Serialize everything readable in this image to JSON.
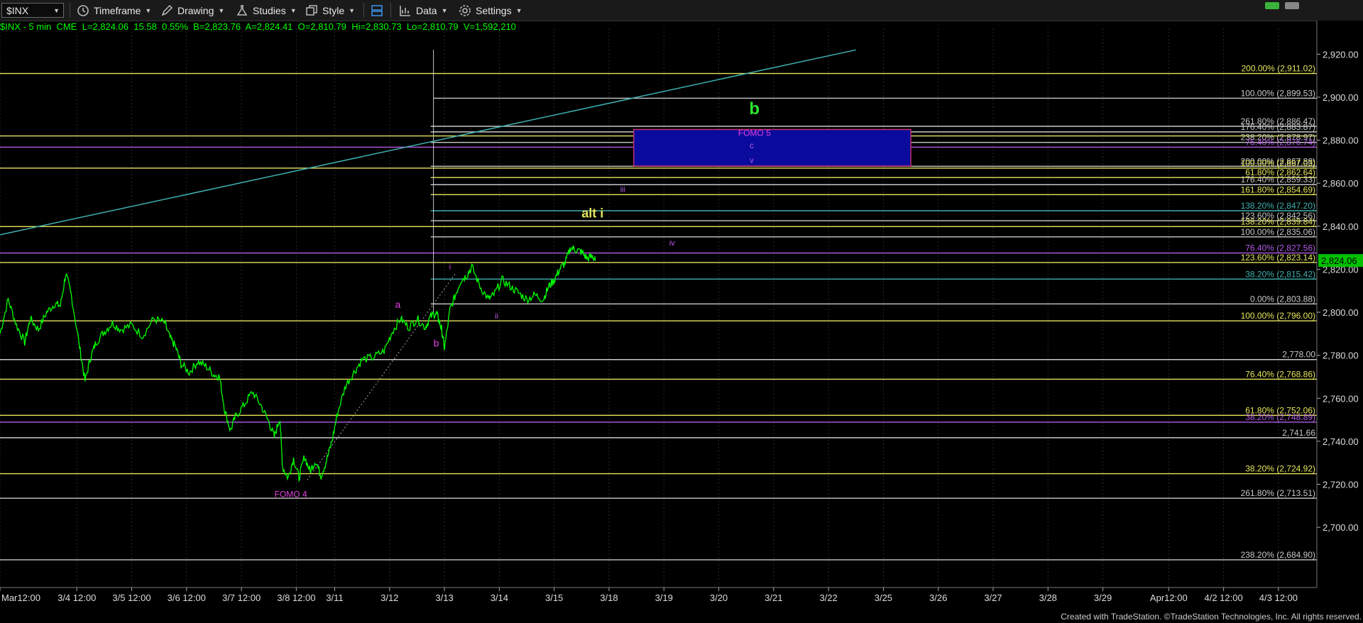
{
  "toolbar": {
    "symbol": "$INX",
    "timeframe": "Timeframe",
    "drawing": "Drawing",
    "studies": "Studies",
    "style": "Style",
    "data": "Data",
    "settings": "Settings"
  },
  "infobar": {
    "title": "$INX - 5 min  CME",
    "last": "L=2,824.06",
    "chg": "15.58",
    "pct": "0.55%",
    "bid": "B=2,823.76",
    "ask": "A=2,824.41",
    "open": "O=2,810.79",
    "hi": "Hi=2,830.73",
    "lo": "Lo=2,810.79",
    "vol": "V=1,592,210"
  },
  "footer": "Created with TradeStation. ©TradeStation Technologies, Inc. All rights reserved.",
  "colors": {
    "price": "#00ff00",
    "yellow": "#e6e65c",
    "white": "#c8c8c8",
    "teal": "#3fb0b0",
    "purple": "#b45ce6",
    "magenta": "#e040e0",
    "box": "#0a0a9c"
  },
  "chart_data": {
    "type": "line",
    "title": "",
    "xlabel": "",
    "ylabel": "",
    "ylim": [
      2672,
      2932
    ],
    "y_ticks": [
      2700,
      2720,
      2740,
      2760,
      2780,
      2800,
      2820,
      2840,
      2860,
      2880,
      2900,
      2920
    ],
    "y_tick_labels": [
      "2,700.00",
      "2,720.00",
      "2,740.00",
      "2,760.00",
      "2,780.00",
      "2,800.00",
      "2,820.00",
      "2,840.00",
      "2,860.00",
      "2,880.00",
      "2,900.00",
      "2,920.00"
    ],
    "x_range": [
      0,
      24
    ],
    "x_ticks": [
      {
        "x": 0.0,
        "label": "Mar12:00"
      },
      {
        "x": 1.4,
        "label": "3/4 12:00"
      },
      {
        "x": 2.4,
        "label": "3/5 12:00"
      },
      {
        "x": 3.4,
        "label": "3/6 12:00"
      },
      {
        "x": 4.4,
        "label": "3/7 12:00"
      },
      {
        "x": 5.4,
        "label": "3/8 12:00"
      },
      {
        "x": 6.1,
        "label": "3/11"
      },
      {
        "x": 7.1,
        "label": "3/12"
      },
      {
        "x": 8.1,
        "label": "3/13"
      },
      {
        "x": 9.1,
        "label": "3/14"
      },
      {
        "x": 10.1,
        "label": "3/15"
      },
      {
        "x": 11.1,
        "label": "3/18"
      },
      {
        "x": 12.1,
        "label": "3/19"
      },
      {
        "x": 13.1,
        "label": "3/20"
      },
      {
        "x": 14.1,
        "label": "3/21"
      },
      {
        "x": 15.1,
        "label": "3/22"
      },
      {
        "x": 16.1,
        "label": "3/25"
      },
      {
        "x": 17.1,
        "label": "3/26"
      },
      {
        "x": 18.1,
        "label": "3/27"
      },
      {
        "x": 19.1,
        "label": "3/28"
      },
      {
        "x": 20.1,
        "label": "3/29"
      },
      {
        "x": 21.3,
        "label": "Apr12:00"
      },
      {
        "x": 22.3,
        "label": "4/2 12:00"
      },
      {
        "x": 23.3,
        "label": "4/3 12:00"
      }
    ],
    "price": {
      "x": [
        0.0,
        0.15,
        0.3,
        0.45,
        0.55,
        0.7,
        0.85,
        1.0,
        1.1,
        1.2,
        1.3,
        1.45,
        1.55,
        1.65,
        1.75,
        1.9,
        2.05,
        2.2,
        2.4,
        2.6,
        2.8,
        3.0,
        3.1,
        3.2,
        3.3,
        3.45,
        3.6,
        3.75,
        3.9,
        4.0,
        4.1,
        4.2,
        4.3,
        4.45,
        4.6,
        4.75,
        4.9,
        5.0,
        5.1,
        5.15,
        5.25,
        5.35,
        5.45,
        5.55,
        5.65,
        5.75,
        5.85,
        5.95,
        6.05,
        6.15,
        6.3,
        6.45,
        6.6,
        6.8,
        7.0,
        7.15,
        7.3,
        7.45,
        7.6,
        7.75,
        7.85,
        7.95,
        8.0,
        8.05,
        8.1,
        8.2,
        8.3,
        8.4,
        8.5,
        8.6,
        8.75,
        8.9,
        9.0,
        9.15,
        9.3,
        9.45,
        9.6,
        9.75,
        9.9,
        10.0,
        10.1,
        10.2,
        10.3,
        10.4,
        10.5,
        10.6,
        10.7,
        10.8,
        10.85
      ],
      "y": [
        2790,
        2806,
        2794,
        2786,
        2797,
        2792,
        2800,
        2804,
        2803,
        2818,
        2808,
        2784,
        2768,
        2779,
        2786,
        2791,
        2795,
        2792,
        2794,
        2789,
        2797,
        2795,
        2788,
        2784,
        2776,
        2772,
        2777,
        2775,
        2771,
        2770,
        2754,
        2745,
        2752,
        2757,
        2763,
        2757,
        2749,
        2742,
        2751,
        2728,
        2723,
        2732,
        2723,
        2733,
        2726,
        2731,
        2724,
        2731,
        2740,
        2753,
        2766,
        2772,
        2778,
        2779,
        2782,
        2791,
        2797,
        2793,
        2797,
        2793,
        2798,
        2800,
        2796,
        2792,
        2783,
        2801,
        2808,
        2815,
        2817,
        2821,
        2812,
        2806,
        2808,
        2815,
        2812,
        2809,
        2806,
        2808,
        2806,
        2812,
        2815,
        2820,
        2823,
        2830,
        2829,
        2828,
        2825,
        2826,
        2824
      ]
    },
    "trendline": {
      "x1": 0.0,
      "y1": 2836,
      "x2": 15.6,
      "y2": 2922
    },
    "dotted_line": {
      "x1": 5.6,
      "y1": 2722,
      "x2": 8.3,
      "y2": 2818
    },
    "vertical_line_x": 7.9,
    "levels": [
      {
        "y": 2911.02,
        "label": "200.00% (2,911.02)",
        "color": "yellow",
        "x_start": 0
      },
      {
        "y": 2899.53,
        "label": "100.00% (2,899.53)",
        "color": "white",
        "x_start": 7.9
      },
      {
        "y": 2886.47,
        "label": "261.80% (2,886.47)",
        "color": "white",
        "x_start": 7.85
      },
      {
        "y": 2883.87,
        "label": "176.40% (2,883.87)",
        "color": "white",
        "x_start": 7.85
      },
      {
        "y": 2882.0,
        "label": "",
        "color": "yellow",
        "x_start": 0
      },
      {
        "y": 2878.97,
        "label": "238.20% (2,878.97)",
        "color": "white",
        "x_start": 7.85
      },
      {
        "y": 2876.74,
        "label": "76.40% (2,876.74)",
        "color": "purple",
        "x_start": 0
      },
      {
        "y": 2867.88,
        "label": "200.00% (2,867.88)",
        "color": "white",
        "x_start": 7.85
      },
      {
        "y": 2867.03,
        "label": "100.00% (2,867.03)",
        "color": "yellow",
        "x_start": 0
      },
      {
        "y": 2862.64,
        "label": "61.80% (2,862.64)",
        "color": "yellow",
        "x_start": 7.85
      },
      {
        "y": 2859.33,
        "label": "176.40% (2,859.33)",
        "color": "white",
        "x_start": 7.85
      },
      {
        "y": 2854.69,
        "label": "161.80% (2,854.69)",
        "color": "yellow",
        "x_start": 7.85
      },
      {
        "y": 2847.2,
        "label": "138.20% (2,847.20)",
        "color": "teal",
        "x_start": 7.85
      },
      {
        "y": 2842.56,
        "label": "123.60% (2,842.56)",
        "color": "white",
        "x_start": 7.85
      },
      {
        "y": 2839.84,
        "label": "138.20% (2,839.84)",
        "color": "yellow",
        "x_start": 0
      },
      {
        "y": 2835.06,
        "label": "100.00% (2,835.06)",
        "color": "white",
        "x_start": 7.85
      },
      {
        "y": 2827.56,
        "label": "76.40% (2,827.56)",
        "color": "purple",
        "x_start": 0
      },
      {
        "y": 2823.14,
        "label": "123.60% (2,823.14)",
        "color": "yellow",
        "x_start": 0
      },
      {
        "y": 2815.42,
        "label": "38.20% (2,815.42)",
        "color": "teal",
        "x_start": 7.85
      },
      {
        "y": 2803.88,
        "label": "0.00% (2,803.88)",
        "color": "white",
        "x_start": 7.85
      },
      {
        "y": 2796.0,
        "label": "100.00% (2,796.00)",
        "color": "yellow",
        "x_start": 0
      },
      {
        "y": 2778.0,
        "label": "2,778.00",
        "color": "white",
        "x_start": 0
      },
      {
        "y": 2768.86,
        "label": "76.40% (2,768.86)",
        "color": "yellow",
        "x_start": 0
      },
      {
        "y": 2752.06,
        "label": "61.80% (2,752.06)",
        "color": "yellow",
        "x_start": 0
      },
      {
        "y": 2748.89,
        "label": "38.20% (2,748.89)",
        "color": "purple",
        "x_start": 0
      },
      {
        "y": 2741.66,
        "label": "2,741.66",
        "color": "white",
        "x_start": 0
      },
      {
        "y": 2724.92,
        "label": "38.20% (2,724.92)",
        "color": "yellow",
        "x_start": 0
      },
      {
        "y": 2713.51,
        "label": "261.80% (2,713.51)",
        "color": "white",
        "x_start": 0
      },
      {
        "y": 2684.9,
        "label": "238.20% (2,684.90)",
        "color": "white",
        "x_start": 0
      }
    ],
    "box": {
      "x1": 11.55,
      "x2": 16.6,
      "y1": 2868,
      "y2": 2885
    },
    "wave_labels": [
      {
        "text": "b",
        "x": 13.75,
        "y": 2892,
        "color": "#2ee62e",
        "size": 24,
        "bold": true
      },
      {
        "text": "FOMO 5",
        "x": 13.75,
        "y": 2882,
        "color": "#e040e0",
        "size": 12,
        "bold": false
      },
      {
        "text": "c",
        "x": 13.7,
        "y": 2876.3,
        "color": "#b45ce6",
        "size": 12,
        "bold": false
      },
      {
        "text": "v",
        "x": 13.7,
        "y": 2869.5,
        "color": "#b45ce6",
        "size": 11,
        "bold": false
      },
      {
        "text": "iii",
        "x": 11.35,
        "y": 2856,
        "color": "#b45ce6",
        "size": 11,
        "bold": false
      },
      {
        "text": "alt i",
        "x": 10.8,
        "y": 2844,
        "color": "#e6e65c",
        "size": 18,
        "bold": true
      },
      {
        "text": "iv",
        "x": 12.25,
        "y": 2831,
        "color": "#b45ce6",
        "size": 11,
        "bold": false
      },
      {
        "text": "i",
        "x": 8.2,
        "y": 2820,
        "color": "#e040e0",
        "size": 11,
        "bold": false
      },
      {
        "text": "a",
        "x": 7.25,
        "y": 2802,
        "color": "#e040e0",
        "size": 14,
        "bold": false
      },
      {
        "text": "ii",
        "x": 9.05,
        "y": 2797,
        "color": "#b45ce6",
        "size": 11,
        "bold": false
      },
      {
        "text": "b",
        "x": 7.95,
        "y": 2784,
        "color": "#e040e0",
        "size": 14,
        "bold": false
      },
      {
        "text": "FOMO 4",
        "x": 5.3,
        "y": 2714,
        "color": "#e040e0",
        "size": 12,
        "bold": false
      }
    ],
    "last_price_marker": {
      "y": 2824.06,
      "label": "2,824.06"
    }
  }
}
